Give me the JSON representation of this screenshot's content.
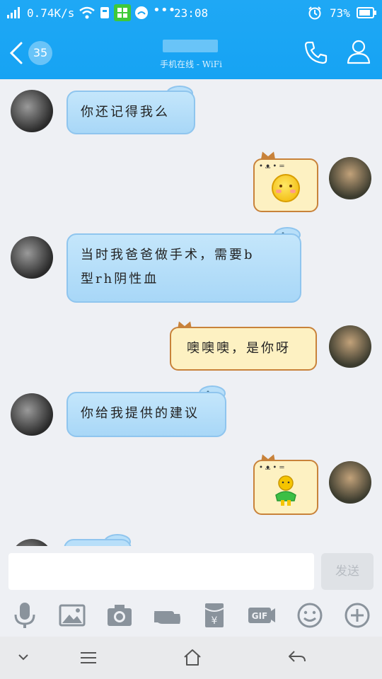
{
  "status_bar": {
    "speed": "0.74K/s",
    "time": "23:08",
    "battery": "73%",
    "icons": [
      "signal-icon",
      "wifi-icon",
      "sim-icon",
      "app-icon",
      "cloud-icon",
      "more-icon",
      "alarm-icon",
      "battery-icon"
    ]
  },
  "header": {
    "back_count": "35",
    "contact_status": "手机在线 - WiFi",
    "icons": [
      "back-icon",
      "phone-icon",
      "profile-icon"
    ]
  },
  "messages": [
    {
      "side": "left",
      "type": "text",
      "text": "你还记得我么"
    },
    {
      "side": "right",
      "type": "emoji",
      "emoji": "blush-face"
    },
    {
      "side": "left",
      "type": "text",
      "text_line1": "当时我爸爸做手术，需要b",
      "text_line2": "型rh阴性血"
    },
    {
      "side": "right",
      "type": "text",
      "text": "噢噢噢，是你呀"
    },
    {
      "side": "left",
      "type": "text",
      "text": "你给我提供的建议"
    },
    {
      "side": "right",
      "type": "emoji",
      "emoji": "person-figure"
    }
  ],
  "input": {
    "placeholder": "",
    "send_label": "发送"
  },
  "toolbar": {
    "icons": [
      "microphone-icon",
      "image-icon",
      "camera-icon",
      "hand-icon",
      "red-packet-icon",
      "gif-icon",
      "smiley-icon",
      "plus-icon"
    ]
  },
  "nav_bar": {
    "icons": [
      "collapse-icon",
      "menu-icon",
      "home-icon",
      "back-nav-icon"
    ]
  },
  "colors": {
    "header_blue": "#16a3f3",
    "bubble_blue": "#a8d7f7",
    "bubble_cat": "#fdf1c2",
    "cat_border": "#c8823a"
  }
}
